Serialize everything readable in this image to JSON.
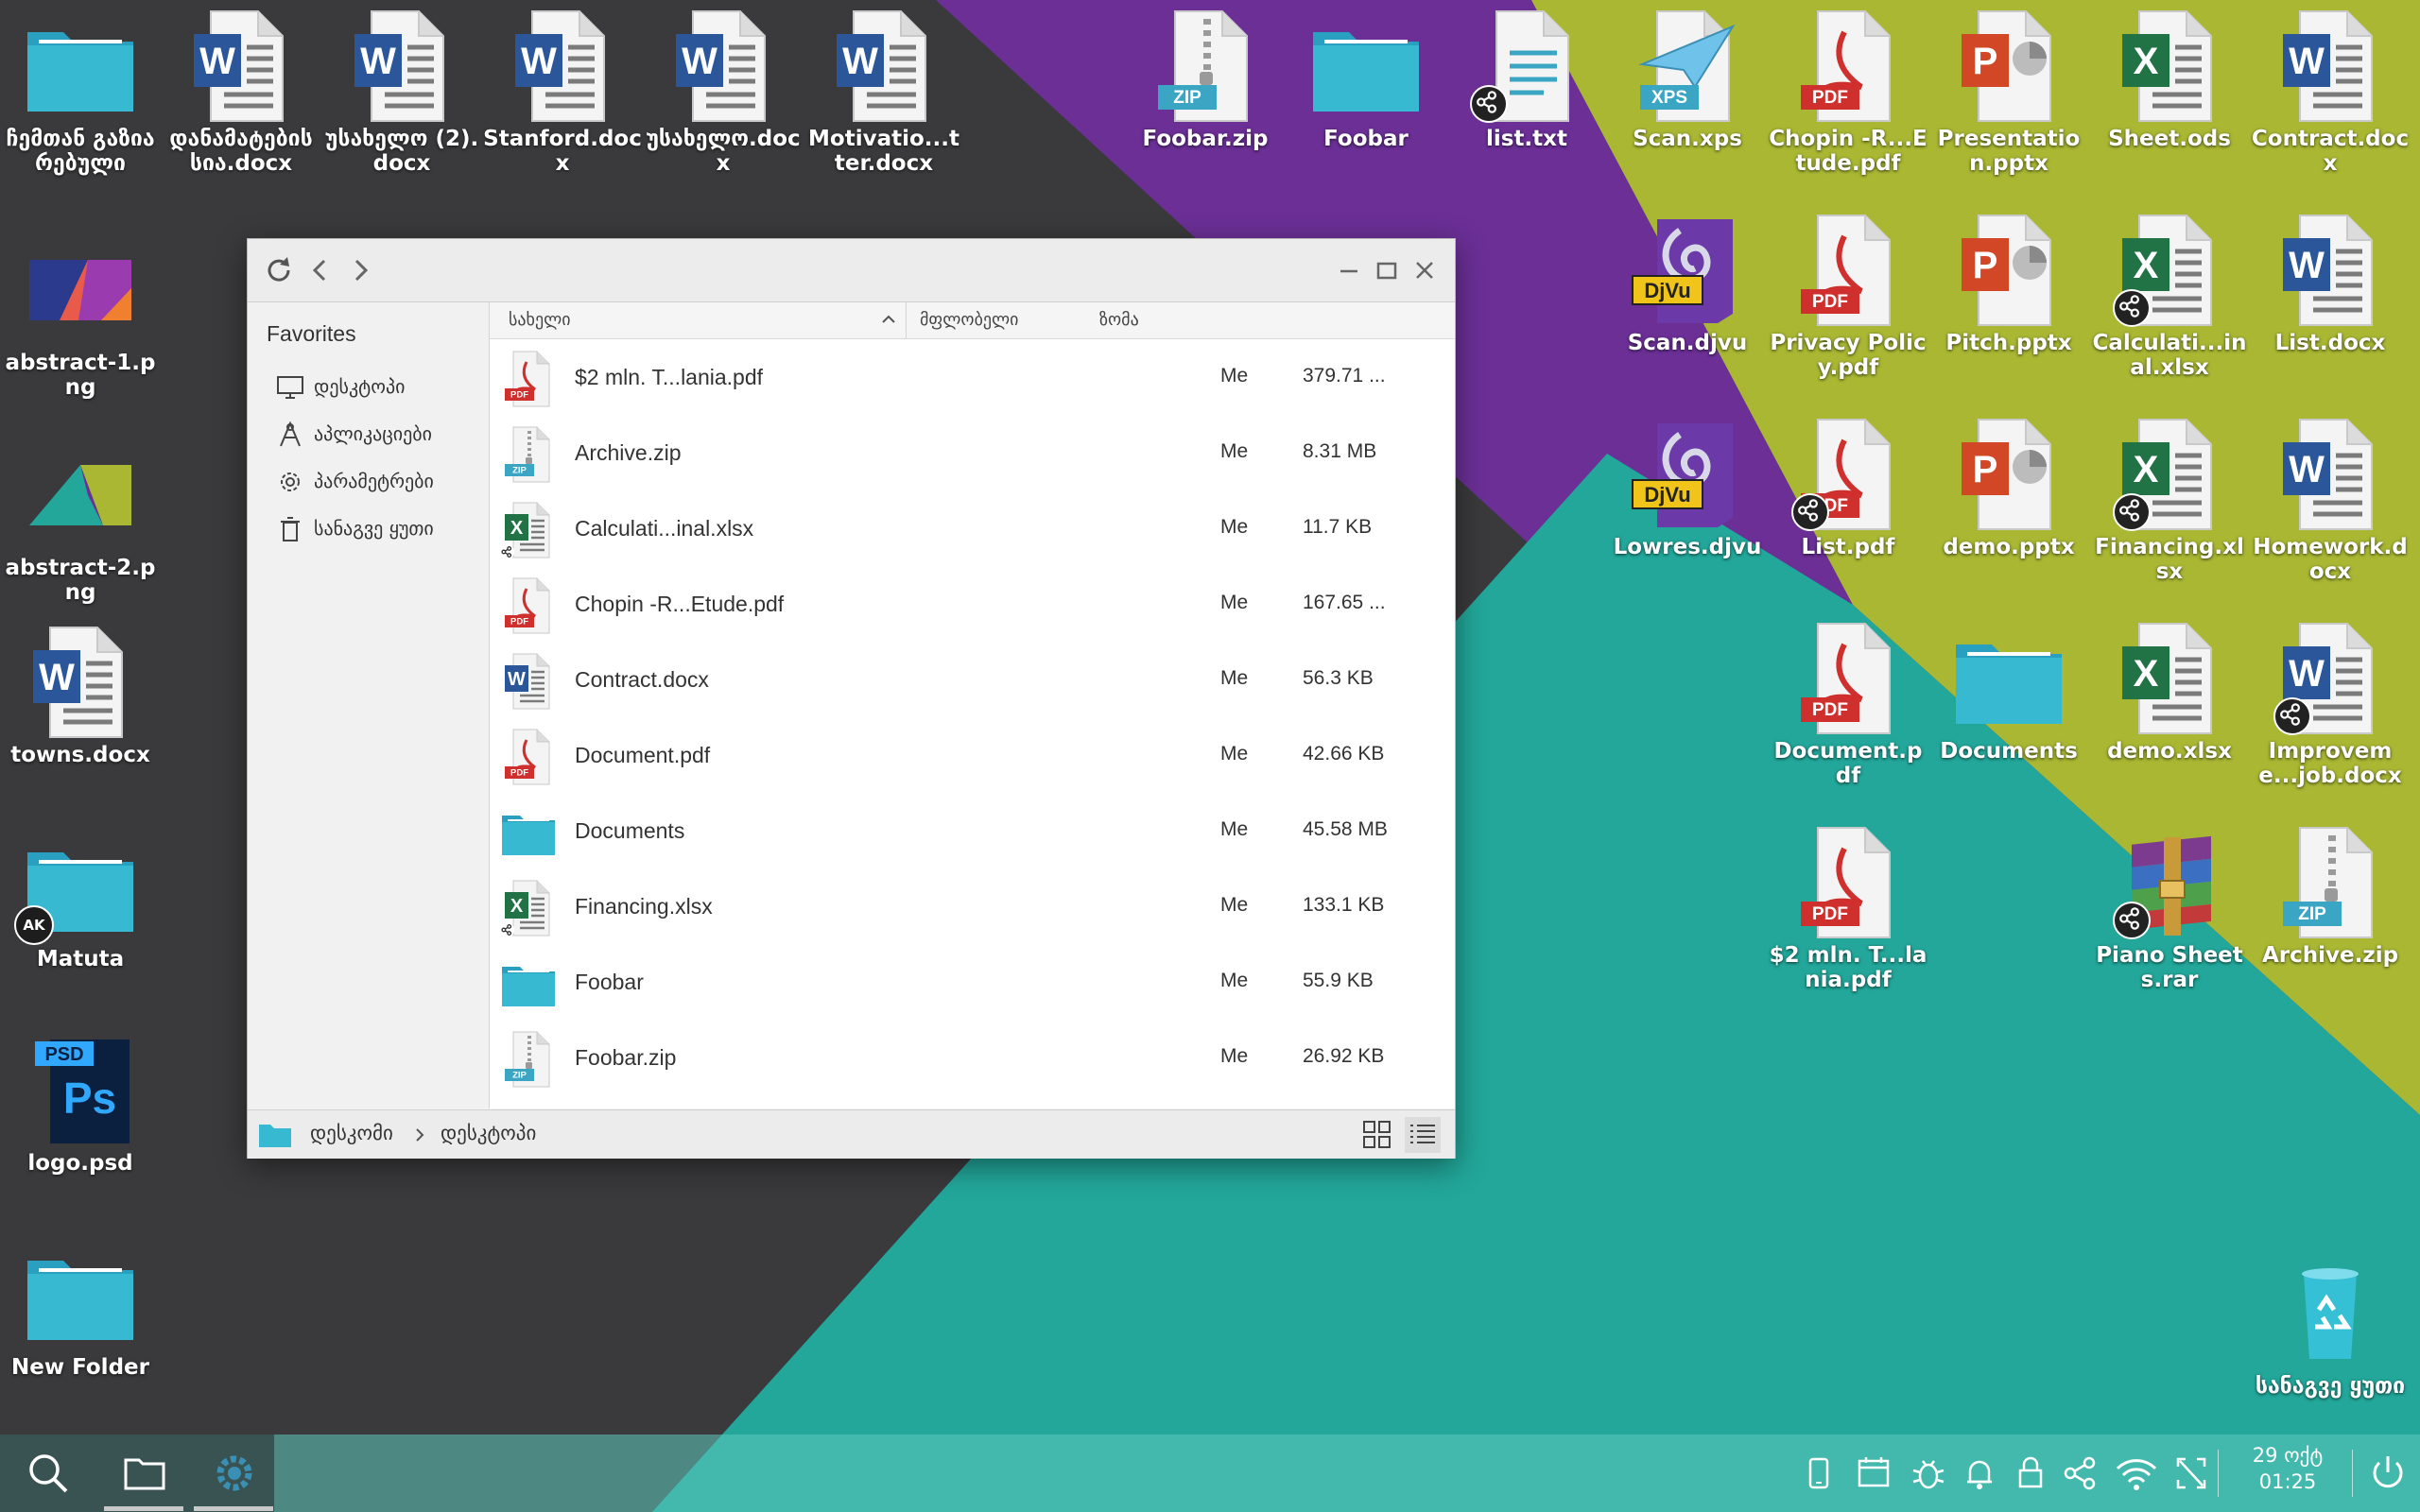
{
  "desktop": {
    "icons": [
      {
        "label": "ჩემთან გაზიარებული",
        "type": "folder",
        "badge": ""
      },
      {
        "label": "დანამატების სია.docx",
        "type": "word",
        "badge": ""
      },
      {
        "label": "უსახელო (2).docx",
        "type": "word",
        "badge": ""
      },
      {
        "label": "Stanford.docx",
        "type": "word",
        "badge": ""
      },
      {
        "label": "უსახელო.docx",
        "type": "word",
        "badge": ""
      },
      {
        "label": "Motivatio...tter.docx",
        "type": "word",
        "badge": ""
      },
      {
        "label": "Foobar.zip",
        "type": "zip",
        "badge": ""
      },
      {
        "label": "Foobar",
        "type": "folder",
        "badge": ""
      },
      {
        "label": "list.txt",
        "type": "txt",
        "badge": "share"
      },
      {
        "label": "Scan.xps",
        "type": "xps",
        "badge": ""
      },
      {
        "label": "Chopin -R...Etude.pdf",
        "type": "pdf",
        "badge": ""
      },
      {
        "label": "Presentation.pptx",
        "type": "ppt",
        "badge": ""
      },
      {
        "label": "Sheet.ods",
        "type": "excel",
        "badge": ""
      },
      {
        "label": "Contract.docx",
        "type": "word",
        "badge": ""
      },
      {
        "label": "abstract-1.png",
        "type": "abstract1",
        "badge": ""
      },
      {
        "label": "abstract-2.png",
        "type": "abstract2",
        "badge": ""
      },
      {
        "label": "towns.docx",
        "type": "word",
        "badge": ""
      },
      {
        "label": "Matuta",
        "type": "folder",
        "badge": "ak"
      },
      {
        "label": "logo.psd",
        "type": "psd",
        "badge": ""
      },
      {
        "label": "New Folder",
        "type": "folder",
        "badge": ""
      },
      {
        "label": "Scan.djvu",
        "type": "djvu",
        "badge": ""
      },
      {
        "label": "Privacy Policy.pdf",
        "type": "pdf",
        "badge": ""
      },
      {
        "label": "Pitch.pptx",
        "type": "ppt",
        "badge": ""
      },
      {
        "label": "Calculati...inal.xlsx",
        "type": "excel",
        "badge": "share"
      },
      {
        "label": "List.docx",
        "type": "word",
        "badge": ""
      },
      {
        "label": "Lowres.djvu",
        "type": "djvu",
        "badge": ""
      },
      {
        "label": "List.pdf",
        "type": "pdf",
        "badge": "share"
      },
      {
        "label": "demo.pptx",
        "type": "ppt",
        "badge": ""
      },
      {
        "label": "Financing.xlsx",
        "type": "excel",
        "badge": "share"
      },
      {
        "label": "Homework.docx",
        "type": "word",
        "badge": ""
      },
      {
        "label": "Document.pdf",
        "type": "pdf",
        "badge": ""
      },
      {
        "label": "Documents",
        "type": "folder",
        "badge": ""
      },
      {
        "label": "demo.xlsx",
        "type": "excel",
        "badge": ""
      },
      {
        "label": "Improveme...job.docx",
        "type": "word",
        "badge": "share"
      },
      {
        "label": "$2 mln. T...lania.pdf",
        "type": "pdf",
        "badge": ""
      },
      {
        "label": "Piano Sheets.rar",
        "type": "rar",
        "badge": "share"
      },
      {
        "label": "Archive.zip",
        "type": "zip",
        "badge": ""
      },
      {
        "label": "სანაგვე ყუთი",
        "type": "trash",
        "badge": ""
      }
    ]
  },
  "file_manager": {
    "sidebar": {
      "heading": "Favorites",
      "items": [
        {
          "label": "დესკტოპი",
          "icon": "monitor-icon"
        },
        {
          "label": "აპლიკაციები",
          "icon": "apps-icon"
        },
        {
          "label": "პარამეტრები",
          "icon": "gear-icon"
        },
        {
          "label": "სანაგვე ყუთი",
          "icon": "trash-icon"
        }
      ]
    },
    "columns": {
      "name": "სახელი",
      "owner": "მფლობელი",
      "size": "ზომა"
    },
    "rows": [
      {
        "name": "$2 mln. T...lania.pdf",
        "type": "pdf",
        "owner": "Me",
        "size": "379.71 ...",
        "shared": false
      },
      {
        "name": "Archive.zip",
        "type": "zip",
        "owner": "Me",
        "size": "8.31 MB",
        "shared": false
      },
      {
        "name": "Calculati...inal.xlsx",
        "type": "excel",
        "owner": "Me",
        "size": "11.7 KB",
        "shared": true
      },
      {
        "name": "Chopin -R...Etude.pdf",
        "type": "pdf",
        "owner": "Me",
        "size": "167.65 ...",
        "shared": false
      },
      {
        "name": "Contract.docx",
        "type": "word",
        "owner": "Me",
        "size": "56.3 KB",
        "shared": false
      },
      {
        "name": "Document.pdf",
        "type": "pdf",
        "owner": "Me",
        "size": "42.66 KB",
        "shared": false
      },
      {
        "name": "Documents",
        "type": "folder",
        "owner": "Me",
        "size": "45.58 MB",
        "shared": false
      },
      {
        "name": "Financing.xlsx",
        "type": "excel",
        "owner": "Me",
        "size": "133.1 KB",
        "shared": true
      },
      {
        "name": "Foobar",
        "type": "folder",
        "owner": "Me",
        "size": "55.9 KB",
        "shared": false
      },
      {
        "name": "Foobar.zip",
        "type": "zip",
        "owner": "Me",
        "size": "26.92 KB",
        "shared": false
      }
    ],
    "breadcrumb": [
      "დესკომი",
      "დესკტოპი"
    ]
  },
  "taskbar": {
    "clock_date": "29 ოქტ",
    "clock_time": "01:25"
  },
  "colors": {
    "dark": "#3a3a3c",
    "purple": "#6b2f96",
    "olive": "#a9b733",
    "teal": "#22a79a",
    "folder": "#37b9d2",
    "word": "#2b579a",
    "excel": "#217346",
    "ppt": "#d24726",
    "pdf": "#d0302d"
  }
}
